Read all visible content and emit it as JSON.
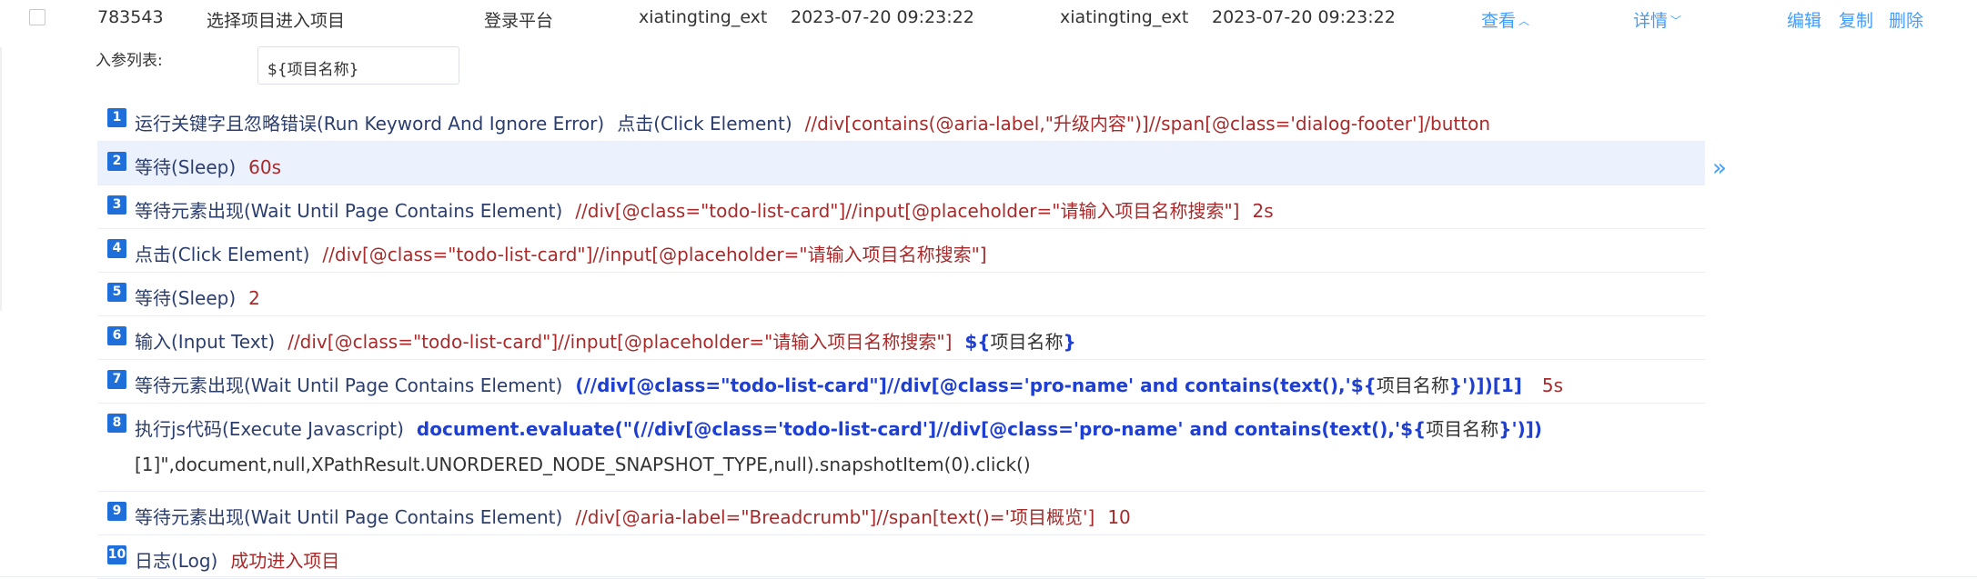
{
  "record": {
    "id": "783543",
    "name": "选择项目进入项目",
    "module": "登录平台",
    "creator": "xiatingting_ext",
    "created_at": "2023-07-20 09:23:22",
    "updater": "xiatingting_ext",
    "updated_at": "2023-07-20 09:23:22",
    "view_label": "查看",
    "detail_label": "详情",
    "edit_label": "编辑",
    "copy_label": "复制",
    "delete_label": "删除"
  },
  "params": {
    "label": "入参列表:",
    "value": "${项目名称}"
  },
  "steps": [
    {
      "num": "1",
      "keyword": "运行关键字且忽略错误(Run Keyword And Ignore Error)",
      "args": [
        "点击(Click Element)",
        "//div[contains(@aria-label,\"升级内容\")]//span[@class='dialog-footer']/button"
      ]
    },
    {
      "num": "2",
      "keyword": "等待(Sleep)",
      "args": [
        "60s"
      ]
    },
    {
      "num": "3",
      "keyword": "等待元素出现(Wait Until Page Contains Element)",
      "args": [
        "//div[@class=\"todo-list-card\"]//input[@placeholder=\"请输入项目名称搜索\"]",
        "2s"
      ]
    },
    {
      "num": "4",
      "keyword": "点击(Click Element)",
      "args": [
        "//div[@class=\"todo-list-card\"]//input[@placeholder=\"请输入项目名称搜索\"]"
      ]
    },
    {
      "num": "5",
      "keyword": "等待(Sleep)",
      "args": [
        "2"
      ]
    },
    {
      "num": "6",
      "keyword": "输入(Input Text)",
      "args": [
        "//div[@class=\"todo-list-card\"]//input[@placeholder=\"请输入项目名称搜索\"]"
      ],
      "var_prefix": "${",
      "var_name": "项目名称",
      "var_suffix": "}"
    },
    {
      "num": "7",
      "keyword": "等待元素出现(Wait Until Page Contains Element)",
      "expr_prefix": "(//div[@class=\"todo-list-card\"]//div[@class='pro-name' and contains(text(),'${",
      "expr_var": "项目名称",
      "expr_suffix": "}')])[1]",
      "tail": "5s"
    },
    {
      "num": "8",
      "keyword": "执行js代码(Execute Javascript)",
      "expr_prefix": "document.evaluate(\"(//div[@class='todo-list-card']//div[@class='pro-name' and contains(text(),'${",
      "expr_var": "项目名称",
      "expr_suffix": "}')])",
      "line2": "[1]\",document,null,XPathResult.UNORDERED_NODE_SNAPSHOT_TYPE,null).snapshotItem(0).click()"
    },
    {
      "num": "9",
      "keyword": "等待元素出现(Wait Until Page Contains Element)",
      "args": [
        "//div[@aria-label=\"Breadcrumb\"]//span[text()='项目概览']",
        "10"
      ]
    },
    {
      "num": "10",
      "keyword": "日志(Log)",
      "args": [
        "成功进入项目"
      ]
    }
  ],
  "icons": {
    "expand": "double-chevron-right-icon",
    "view_chevron": "chevron-up-icon",
    "detail_chevron": "chevron-down-icon"
  },
  "colors": {
    "link": "#409eff",
    "badge": "#1e6fd9",
    "arg": "#a82a2a",
    "var": "#1f3fd1",
    "active_row": "#ecf2fd"
  }
}
